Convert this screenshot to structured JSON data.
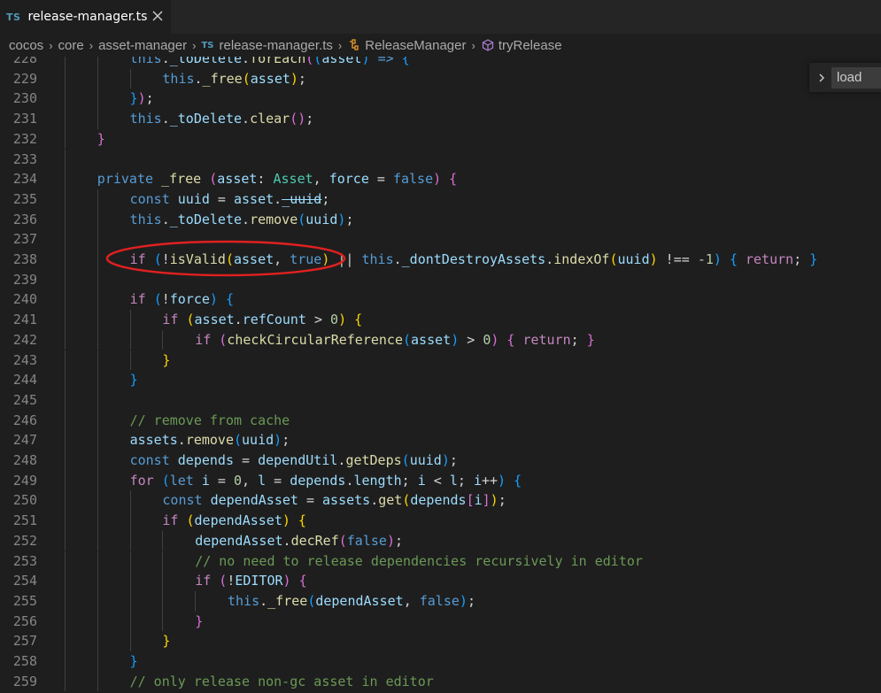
{
  "tab": {
    "badge": "TS",
    "title": "release-manager.ts"
  },
  "breadcrumb": {
    "items": [
      "cocos",
      "core",
      "asset-manager",
      "release-manager.ts",
      "ReleaseManager",
      "tryRelease"
    ],
    "ts_badge": "TS"
  },
  "find_widget": {
    "value": "load"
  },
  "code": [
    {
      "num": "228",
      "indent": 2,
      "tokens": [
        [
          "k-kw",
          "this"
        ],
        [
          "k-txt",
          "."
        ],
        [
          "k-var",
          "_toDelete"
        ],
        [
          "k-txt",
          "."
        ],
        [
          "k-fn",
          "forEach"
        ],
        [
          "k-b2",
          "("
        ],
        [
          "k-b3",
          "("
        ],
        [
          "k-var",
          "asset"
        ],
        [
          "k-b3",
          ")"
        ],
        [
          "k-txt",
          " "
        ],
        [
          "k-kw",
          "=>"
        ],
        [
          "k-txt",
          " "
        ],
        [
          "k-b3",
          "{"
        ]
      ]
    },
    {
      "num": "229",
      "indent": 3,
      "tokens": [
        [
          "k-kw",
          "this"
        ],
        [
          "k-txt",
          "."
        ],
        [
          "k-fn",
          "_free"
        ],
        [
          "k-b1",
          "("
        ],
        [
          "k-var",
          "asset"
        ],
        [
          "k-b1",
          ")"
        ],
        [
          "k-txt",
          ";"
        ]
      ]
    },
    {
      "num": "230",
      "indent": 2,
      "tokens": [
        [
          "k-b3",
          "}"
        ],
        [
          "k-b2",
          ")"
        ],
        [
          "k-txt",
          ";"
        ]
      ]
    },
    {
      "num": "231",
      "indent": 2,
      "tokens": [
        [
          "k-kw",
          "this"
        ],
        [
          "k-txt",
          "."
        ],
        [
          "k-var",
          "_toDelete"
        ],
        [
          "k-txt",
          "."
        ],
        [
          "k-fn",
          "clear"
        ],
        [
          "k-b2",
          "()"
        ],
        [
          "k-txt",
          ";"
        ]
      ]
    },
    {
      "num": "232",
      "indent": 1,
      "tokens": [
        [
          "k-b2",
          "}"
        ]
      ]
    },
    {
      "num": "233",
      "indent": 0,
      "tokens": []
    },
    {
      "num": "234",
      "indent": 1,
      "tokens": [
        [
          "k-kw",
          "private"
        ],
        [
          "k-txt",
          " "
        ],
        [
          "k-fn",
          "_free"
        ],
        [
          "k-txt",
          " "
        ],
        [
          "k-b2",
          "("
        ],
        [
          "k-var",
          "asset"
        ],
        [
          "k-txt",
          ": "
        ],
        [
          "k-type",
          "Asset"
        ],
        [
          "k-txt",
          ", "
        ],
        [
          "k-var",
          "force"
        ],
        [
          "k-txt",
          " = "
        ],
        [
          "k-kw",
          "false"
        ],
        [
          "k-b2",
          ")"
        ],
        [
          "k-txt",
          " "
        ],
        [
          "k-b2",
          "{"
        ]
      ]
    },
    {
      "num": "235",
      "indent": 2,
      "tokens": [
        [
          "k-kw",
          "const"
        ],
        [
          "k-txt",
          " "
        ],
        [
          "k-var",
          "uuid"
        ],
        [
          "k-txt",
          " = "
        ],
        [
          "k-var",
          "asset"
        ],
        [
          "k-txt",
          "."
        ],
        [
          "k-var strike",
          "_uuid"
        ],
        [
          "k-txt",
          ";"
        ]
      ]
    },
    {
      "num": "236",
      "indent": 2,
      "tokens": [
        [
          "k-kw",
          "this"
        ],
        [
          "k-txt",
          "."
        ],
        [
          "k-var",
          "_toDelete"
        ],
        [
          "k-txt",
          "."
        ],
        [
          "k-fn",
          "remove"
        ],
        [
          "k-b3",
          "("
        ],
        [
          "k-var",
          "uuid"
        ],
        [
          "k-b3",
          ")"
        ],
        [
          "k-txt",
          ";"
        ]
      ]
    },
    {
      "num": "237",
      "indent": 0,
      "tokens": []
    },
    {
      "num": "238",
      "indent": 2,
      "tokens": [
        [
          "k-ctrl",
          "if"
        ],
        [
          "k-txt",
          " "
        ],
        [
          "k-b3",
          "("
        ],
        [
          "k-txt",
          "!"
        ],
        [
          "k-fn",
          "isValid"
        ],
        [
          "k-b1",
          "("
        ],
        [
          "k-var",
          "asset"
        ],
        [
          "k-txt",
          ", "
        ],
        [
          "k-kw",
          "true"
        ],
        [
          "k-b1",
          ")"
        ],
        [
          "k-txt",
          " || "
        ],
        [
          "k-kw",
          "this"
        ],
        [
          "k-txt",
          "."
        ],
        [
          "k-var",
          "_dontDestroyAssets"
        ],
        [
          "k-txt",
          "."
        ],
        [
          "k-fn",
          "indexOf"
        ],
        [
          "k-b1",
          "("
        ],
        [
          "k-var",
          "uuid"
        ],
        [
          "k-b1",
          ")"
        ],
        [
          "k-txt",
          " !== "
        ],
        [
          "k-num",
          "-1"
        ],
        [
          "k-b3",
          ")"
        ],
        [
          "k-txt",
          " "
        ],
        [
          "k-b3",
          "{"
        ],
        [
          "k-txt",
          " "
        ],
        [
          "k-ctrl",
          "return"
        ],
        [
          "k-txt",
          "; "
        ],
        [
          "k-b3",
          "}"
        ]
      ]
    },
    {
      "num": "239",
      "indent": 0,
      "tokens": []
    },
    {
      "num": "240",
      "indent": 2,
      "tokens": [
        [
          "k-ctrl",
          "if"
        ],
        [
          "k-txt",
          " "
        ],
        [
          "k-b3",
          "("
        ],
        [
          "k-txt",
          "!"
        ],
        [
          "k-var",
          "force"
        ],
        [
          "k-b3",
          ")"
        ],
        [
          "k-txt",
          " "
        ],
        [
          "k-b3",
          "{"
        ]
      ]
    },
    {
      "num": "241",
      "indent": 3,
      "tokens": [
        [
          "k-ctrl",
          "if"
        ],
        [
          "k-txt",
          " "
        ],
        [
          "k-b1",
          "("
        ],
        [
          "k-var",
          "asset"
        ],
        [
          "k-txt",
          "."
        ],
        [
          "k-var",
          "refCount"
        ],
        [
          "k-txt",
          " > "
        ],
        [
          "k-num",
          "0"
        ],
        [
          "k-b1",
          ")"
        ],
        [
          "k-txt",
          " "
        ],
        [
          "k-b1",
          "{"
        ]
      ]
    },
    {
      "num": "242",
      "indent": 4,
      "tokens": [
        [
          "k-ctrl",
          "if"
        ],
        [
          "k-txt",
          " "
        ],
        [
          "k-b2",
          "("
        ],
        [
          "k-fn",
          "checkCircularReference"
        ],
        [
          "k-b3",
          "("
        ],
        [
          "k-var",
          "asset"
        ],
        [
          "k-b3",
          ")"
        ],
        [
          "k-txt",
          " > "
        ],
        [
          "k-num",
          "0"
        ],
        [
          "k-b2",
          ")"
        ],
        [
          "k-txt",
          " "
        ],
        [
          "k-b2",
          "{"
        ],
        [
          "k-txt",
          " "
        ],
        [
          "k-ctrl",
          "return"
        ],
        [
          "k-txt",
          "; "
        ],
        [
          "k-b2",
          "}"
        ]
      ]
    },
    {
      "num": "243",
      "indent": 3,
      "tokens": [
        [
          "k-b1",
          "}"
        ]
      ]
    },
    {
      "num": "244",
      "indent": 2,
      "tokens": [
        [
          "k-b3",
          "}"
        ]
      ]
    },
    {
      "num": "245",
      "indent": 0,
      "tokens": []
    },
    {
      "num": "246",
      "indent": 2,
      "tokens": [
        [
          "k-com",
          "// remove from cache"
        ]
      ]
    },
    {
      "num": "247",
      "indent": 2,
      "tokens": [
        [
          "k-var",
          "assets"
        ],
        [
          "k-txt",
          "."
        ],
        [
          "k-fn",
          "remove"
        ],
        [
          "k-b3",
          "("
        ],
        [
          "k-var",
          "uuid"
        ],
        [
          "k-b3",
          ")"
        ],
        [
          "k-txt",
          ";"
        ]
      ]
    },
    {
      "num": "248",
      "indent": 2,
      "tokens": [
        [
          "k-kw",
          "const"
        ],
        [
          "k-txt",
          " "
        ],
        [
          "k-var",
          "depends"
        ],
        [
          "k-txt",
          " = "
        ],
        [
          "k-var",
          "dependUtil"
        ],
        [
          "k-txt",
          "."
        ],
        [
          "k-fn",
          "getDeps"
        ],
        [
          "k-b3",
          "("
        ],
        [
          "k-var",
          "uuid"
        ],
        [
          "k-b3",
          ")"
        ],
        [
          "k-txt",
          ";"
        ]
      ]
    },
    {
      "num": "249",
      "indent": 2,
      "tokens": [
        [
          "k-ctrl",
          "for"
        ],
        [
          "k-txt",
          " "
        ],
        [
          "k-b3",
          "("
        ],
        [
          "k-kw",
          "let"
        ],
        [
          "k-txt",
          " "
        ],
        [
          "k-var",
          "i"
        ],
        [
          "k-txt",
          " = "
        ],
        [
          "k-num",
          "0"
        ],
        [
          "k-txt",
          ", "
        ],
        [
          "k-var",
          "l"
        ],
        [
          "k-txt",
          " = "
        ],
        [
          "k-var",
          "depends"
        ],
        [
          "k-txt",
          "."
        ],
        [
          "k-var",
          "length"
        ],
        [
          "k-txt",
          "; "
        ],
        [
          "k-var",
          "i"
        ],
        [
          "k-txt",
          " < "
        ],
        [
          "k-var",
          "l"
        ],
        [
          "k-txt",
          "; "
        ],
        [
          "k-var",
          "i"
        ],
        [
          "k-txt",
          "++"
        ],
        [
          "k-b3",
          ")"
        ],
        [
          "k-txt",
          " "
        ],
        [
          "k-b3",
          "{"
        ]
      ]
    },
    {
      "num": "250",
      "indent": 3,
      "tokens": [
        [
          "k-kw",
          "const"
        ],
        [
          "k-txt",
          " "
        ],
        [
          "k-var",
          "dependAsset"
        ],
        [
          "k-txt",
          " = "
        ],
        [
          "k-var",
          "assets"
        ],
        [
          "k-txt",
          "."
        ],
        [
          "k-fn",
          "get"
        ],
        [
          "k-b1",
          "("
        ],
        [
          "k-var",
          "depends"
        ],
        [
          "k-b2",
          "["
        ],
        [
          "k-var",
          "i"
        ],
        [
          "k-b2",
          "]"
        ],
        [
          "k-b1",
          ")"
        ],
        [
          "k-txt",
          ";"
        ]
      ]
    },
    {
      "num": "251",
      "indent": 3,
      "tokens": [
        [
          "k-ctrl",
          "if"
        ],
        [
          "k-txt",
          " "
        ],
        [
          "k-b1",
          "("
        ],
        [
          "k-var",
          "dependAsset"
        ],
        [
          "k-b1",
          ")"
        ],
        [
          "k-txt",
          " "
        ],
        [
          "k-b1",
          "{"
        ]
      ]
    },
    {
      "num": "252",
      "indent": 4,
      "tokens": [
        [
          "k-var",
          "dependAsset"
        ],
        [
          "k-txt",
          "."
        ],
        [
          "k-fn",
          "decRef"
        ],
        [
          "k-b2",
          "("
        ],
        [
          "k-kw",
          "false"
        ],
        [
          "k-b2",
          ")"
        ],
        [
          "k-txt",
          ";"
        ]
      ]
    },
    {
      "num": "253",
      "indent": 4,
      "tokens": [
        [
          "k-com",
          "// no need to release dependencies recursively in editor"
        ]
      ]
    },
    {
      "num": "254",
      "indent": 4,
      "tokens": [
        [
          "k-ctrl",
          "if"
        ],
        [
          "k-txt",
          " "
        ],
        [
          "k-b2",
          "("
        ],
        [
          "k-txt",
          "!"
        ],
        [
          "k-var",
          "EDITOR"
        ],
        [
          "k-b2",
          ")"
        ],
        [
          "k-txt",
          " "
        ],
        [
          "k-b2",
          "{"
        ]
      ]
    },
    {
      "num": "255",
      "indent": 5,
      "tokens": [
        [
          "k-kw",
          "this"
        ],
        [
          "k-txt",
          "."
        ],
        [
          "k-fn",
          "_free"
        ],
        [
          "k-b3",
          "("
        ],
        [
          "k-var",
          "dependAsset"
        ],
        [
          "k-txt",
          ", "
        ],
        [
          "k-kw",
          "false"
        ],
        [
          "k-b3",
          ")"
        ],
        [
          "k-txt",
          ";"
        ]
      ]
    },
    {
      "num": "256",
      "indent": 4,
      "tokens": [
        [
          "k-b2",
          "}"
        ]
      ]
    },
    {
      "num": "257",
      "indent": 3,
      "tokens": [
        [
          "k-b1",
          "}"
        ]
      ]
    },
    {
      "num": "258",
      "indent": 2,
      "tokens": [
        [
          "k-b3",
          "}"
        ]
      ]
    },
    {
      "num": "259",
      "indent": 2,
      "tokens": [
        [
          "k-com",
          "// only release non-gc asset in editor"
        ]
      ]
    }
  ]
}
